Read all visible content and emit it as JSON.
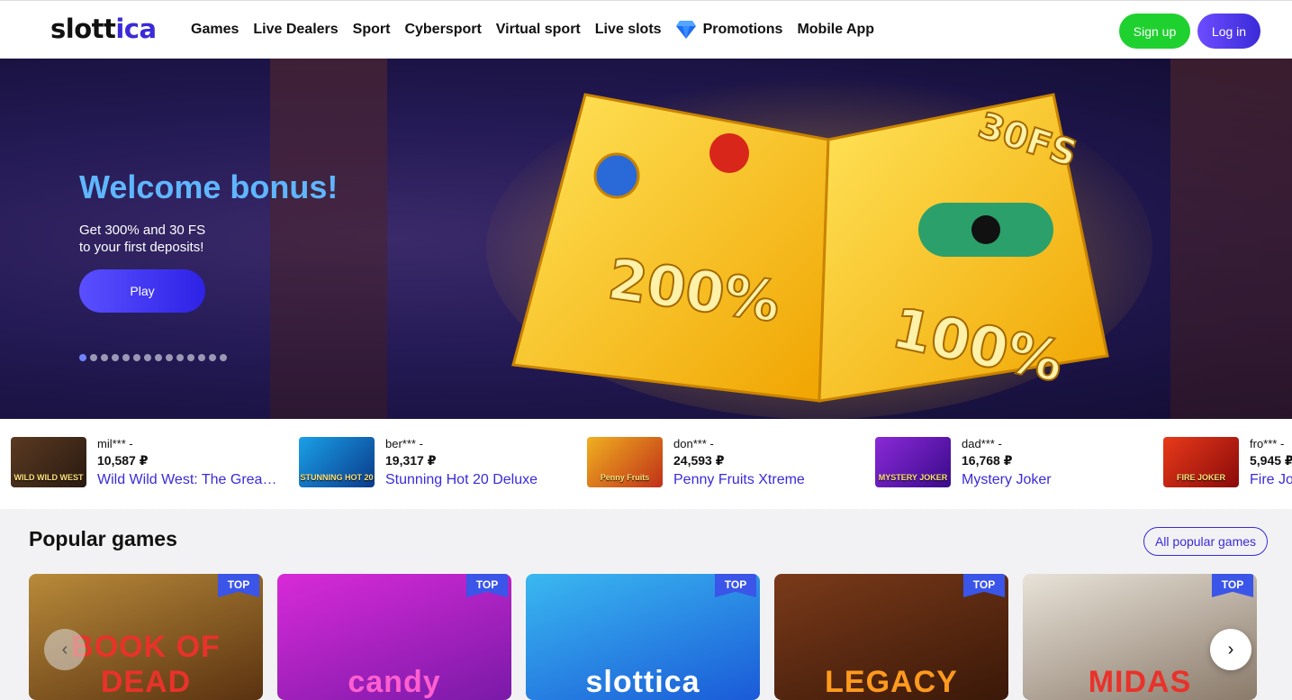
{
  "header": {
    "logo_prefix": "slott",
    "logo_accent": "ica",
    "nav": [
      "Games",
      "Live Dealers",
      "Sport",
      "Cybersport",
      "Virtual sport",
      "Live slots",
      "Promotions",
      "Mobile App"
    ],
    "signup_label": "Sign up",
    "login_label": "Log in"
  },
  "hero": {
    "title": "Welcome bonus!",
    "subtitle_line1": "Get 300% and 30 FS",
    "subtitle_line2": "to your first deposits!",
    "play_label": "Play",
    "slide_count": 14,
    "active_slide": 1,
    "art_text": {
      "fs": "30FS",
      "left_pct": "200%",
      "right_pct": "100%"
    }
  },
  "winners": [
    {
      "user": "mil*** -",
      "amount": "10,587 ₽",
      "game": "Wild Wild West: The Great ...",
      "thumb_label": "WILD WILD WEST"
    },
    {
      "user": "ber*** -",
      "amount": "19,317 ₽",
      "game": "Stunning Hot 20 Deluxe",
      "thumb_label": "STUNNING HOT 20"
    },
    {
      "user": "don*** -",
      "amount": "24,593 ₽",
      "game": "Penny Fruits Xtreme",
      "thumb_label": "Penny Fruits"
    },
    {
      "user": "dad*** -",
      "amount": "16,768 ₽",
      "game": "Mystery Joker",
      "thumb_label": "MYSTERY JOKER"
    },
    {
      "user": "fro*** -",
      "amount": "5,945 ₽",
      "game": "Fire Jo",
      "thumb_label": "FIRE JOKER"
    }
  ],
  "popular": {
    "title": "Popular games",
    "all_label": "All popular games",
    "badge_label": "TOP",
    "cards": [
      {
        "title": "BOOK OF DEAD",
        "title_color": "#e8322a"
      },
      {
        "title": "candy",
        "title_color": "#ff5fd0"
      },
      {
        "title": "slottica",
        "title_color": "#ffffff"
      },
      {
        "title": "LEGACY",
        "title_color": "#ff9a1e"
      },
      {
        "title": "MIDAS",
        "title_color": "#e8322a"
      }
    ]
  },
  "colors": {
    "brand": "#3a2bd8",
    "signup": "#1fd12f",
    "hero_title": "#5fb6ff"
  }
}
